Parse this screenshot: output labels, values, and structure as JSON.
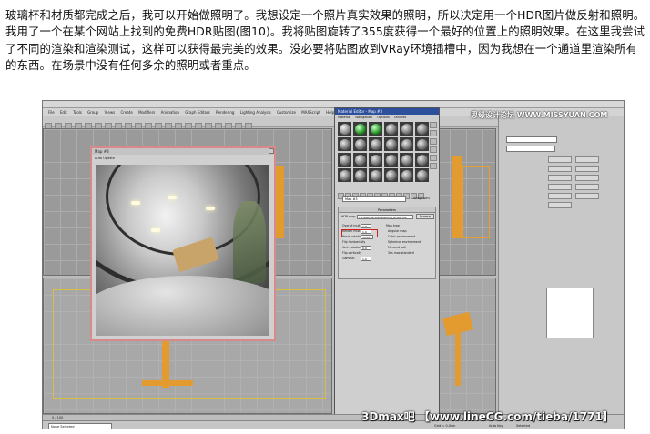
{
  "article": {
    "paragraph": "玻璃杯和材质都完成之后，我可以开始做照明了。我想设定一个照片真实效果的照明，所以决定用一个HDR图片做反射和照明。我用了一个在某个网站上找到的免费HDR贴图(图10)。我将贴图旋转了355度获得一个最好的位置上的照明效果。在这里我尝试了不同的渲染和渲染测试，这样可以获得最完美的效果。没必要将贴图放到VRay环境插槽中，因为我想在一个通道里渲染所有的东西。在场景中没有任何多余的照明或者重点。"
  },
  "screenshot": {
    "menus": [
      "File",
      "Edit",
      "Tools",
      "Group",
      "Views",
      "Create",
      "Modifiers",
      "Animation",
      "Graph Editors",
      "Rendering",
      "Lighting Analysis",
      "Customize",
      "MAXScript",
      "Help",
      "VR_Bits",
      "VRayStudio"
    ],
    "watermark_top": "思缘设计论坛  WWW.MISSYUAN.COM",
    "watermark_bottom": "3Dmax吧 【www.lineCG.com/tieba/1771】",
    "hdr_window": {
      "title": "Map #3",
      "toolbar": "Auto    Update"
    },
    "material_editor": {
      "title": "Material Editor - Map #3",
      "menus": [
        "Material",
        "Navigation",
        "Options",
        "Utilities"
      ],
      "map_name": "Map #3",
      "map_type": "VRayHDRI",
      "rollout": "Parameters",
      "hdr_map_label": "HDR map:",
      "hdr_map_path": "F:\\HDRI\\VRHDRI\\building_probe.hdr",
      "browse": "Browse",
      "overall_mult_label": "Overall mult:",
      "overall_mult": "1.0",
      "render_mult_label": "Render mult:",
      "render_mult": "1.0",
      "horiz_rotation_label": "Horiz. rotation:",
      "horiz_rotation": "355.0",
      "flip_horizontally": "Flip horizontally",
      "vert_rotation_label": "Vert. rotation:",
      "vert_rotation": "0.0",
      "flip_vertically": "Flip vertically",
      "gamma_label": "Gamma:",
      "gamma": "1.0",
      "map_type_header": "Map type",
      "map_types": [
        "Angular map",
        "Cubic environment",
        "Spherical environment",
        "Mirrored ball",
        "3ds max standard"
      ]
    },
    "status": {
      "selected": "None Selected",
      "frame": "0 / 100",
      "grid": "Grid = 0.0cm",
      "autokey": "Auto Key",
      "selected_dropdown": "Selected"
    }
  }
}
